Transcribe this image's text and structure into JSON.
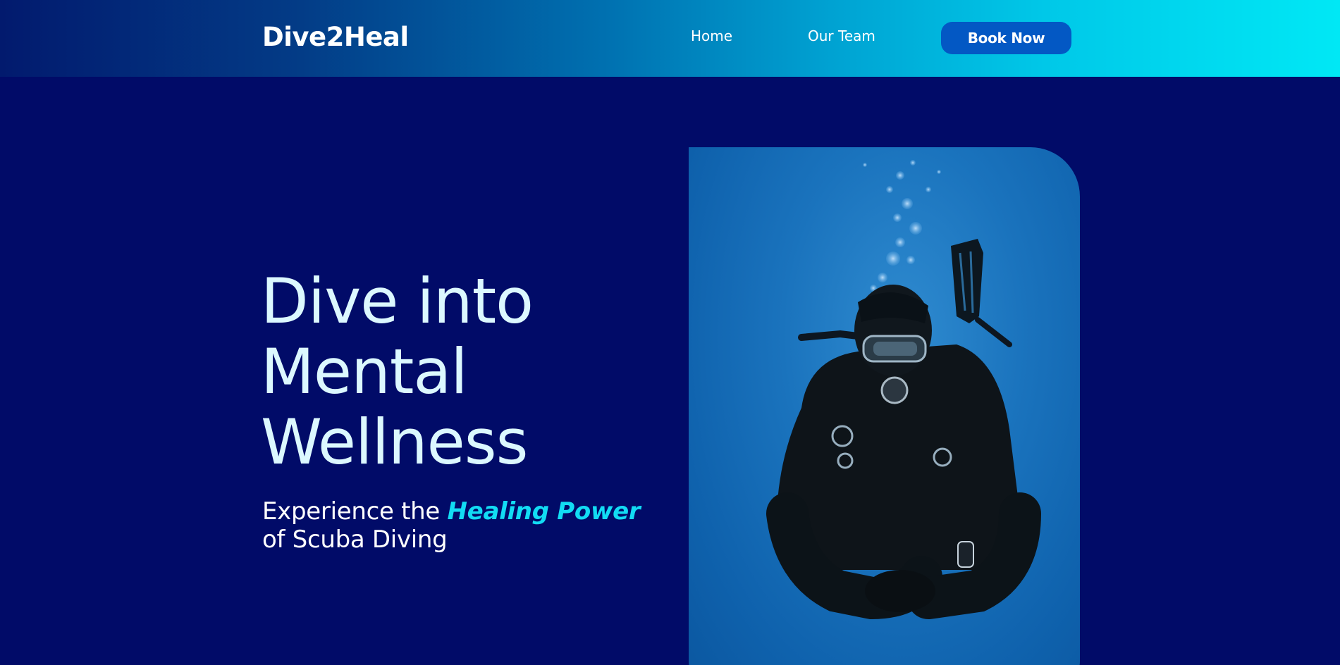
{
  "header": {
    "logo": "Dive2Heal",
    "nav": [
      {
        "label": "Home"
      },
      {
        "label": "Our Team"
      }
    ],
    "cta_label": "Book Now"
  },
  "hero": {
    "title_lines": [
      "Dive into",
      "Mental",
      "Wellness"
    ],
    "subtitle_prefix": "Experience the",
    "subtitle_accent": "Healing Power",
    "subtitle_suffix": "of Scuba Diving"
  },
  "colors": {
    "background": "#010b68",
    "header_gradient_start": "#021a6e",
    "header_gradient_end": "#00e8f5",
    "button": "#0358c4",
    "title": "#dcf8ff",
    "accent": "#12dcf4"
  },
  "image": {
    "subject": "scuba-diver-photo"
  }
}
